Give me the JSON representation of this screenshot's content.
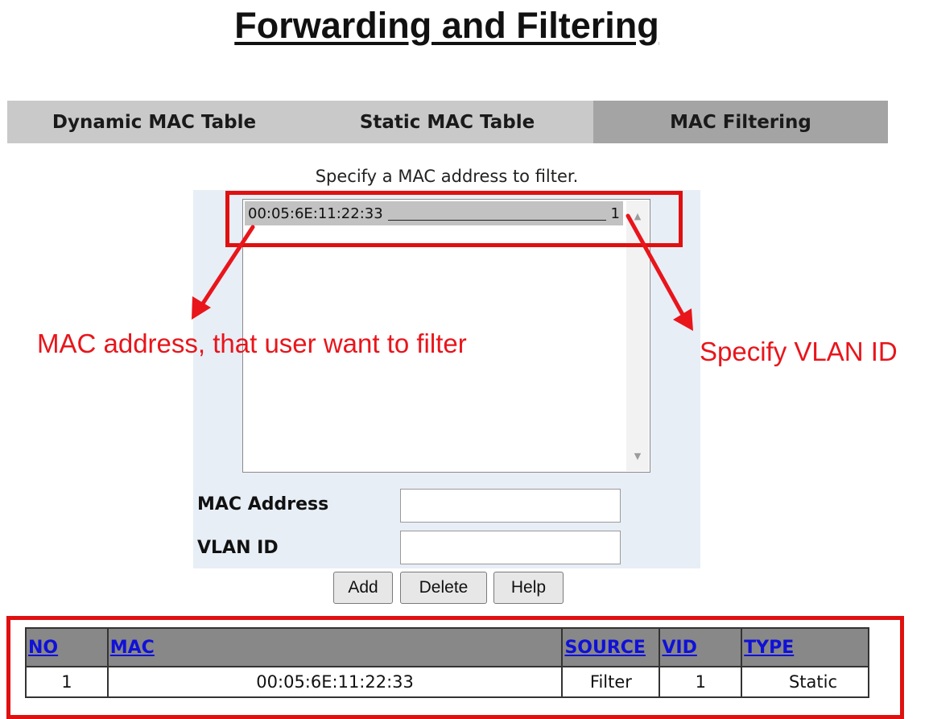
{
  "page": {
    "title": "Forwarding and Filtering"
  },
  "tabs": [
    {
      "label": "Dynamic MAC Table"
    },
    {
      "label": "Static MAC Table"
    },
    {
      "label": "MAC Filtering",
      "active": true
    }
  ],
  "filter_panel": {
    "instruction": "Specify a MAC address to filter.",
    "list_entries": [
      {
        "mac": "00:05:6E:11:22:33",
        "vlan": "1"
      }
    ],
    "mac_address_label": "MAC Address",
    "mac_address_value": "",
    "vlan_id_label": "VLAN ID",
    "vlan_id_value": ""
  },
  "buttons": {
    "add": "Add",
    "delete": "Delete",
    "help": "Help"
  },
  "annotations": {
    "mac_note": "MAC address, that user want to filter",
    "vlan_note": "Specify VLAN ID",
    "color": "#e8151b"
  },
  "table": {
    "headers": [
      "NO",
      "MAC",
      "SOURCE",
      "VID",
      "TYPE"
    ],
    "rows": [
      [
        "1",
        "00:05:6E:11:22:33",
        "Filter",
        "1",
        "Static"
      ]
    ]
  },
  "colors": {
    "tabbar": "#c9c9c9",
    "active_tab": "#a4a4a4",
    "header_link": "#1010d8",
    "table_header": "#888888",
    "panel": "#e8eef6"
  },
  "icons": {
    "scroll_up": "scroll-up-arrow-icon",
    "scroll_down": "scroll-down-arrow-icon"
  }
}
